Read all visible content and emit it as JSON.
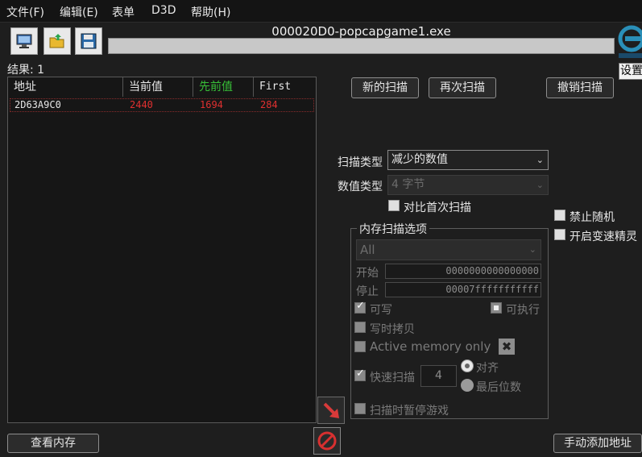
{
  "menu": [
    "文件(F)",
    "编辑(E)",
    "表单",
    "D3D",
    "帮助(H)"
  ],
  "process_title": "000020D0-popcapgame1.exe",
  "settings_label": "设置",
  "result_label": "结果: 1",
  "columns": [
    "地址",
    "当前值",
    "先前值",
    "First"
  ],
  "rows": [
    {
      "address": "2D63A9C0",
      "current": "2440",
      "previous": "1694",
      "first": "284"
    }
  ],
  "buttons": {
    "new_scan": "新的扫描",
    "next_scan": "再次扫描",
    "undo_scan": "撤销扫描",
    "view_memory": "查看内存",
    "add_address": "手动添加地址"
  },
  "scan_type": {
    "label": "扫描类型",
    "value": "减少的数值"
  },
  "value_type": {
    "label": "数值类型",
    "value": "4 字节"
  },
  "compare_first": "对比首次扫描",
  "no_random": "禁止随机",
  "speedhack": "开启变速精灵",
  "memory_options": {
    "title": "内存扫描选项",
    "region": "All",
    "start_label": "开始",
    "start_value": "0000000000000000",
    "stop_label": "停止",
    "stop_value": "00007fffffffffff",
    "writable": "可写",
    "executable": "可执行",
    "copy_on_write": "写时拷贝",
    "active_memory": "Active memory only",
    "fast_scan": "快速扫描",
    "fast_scan_value": "4",
    "align": "对齐",
    "last_digits": "最后位数",
    "pause_game": "扫描时暂停游戏"
  },
  "colors": {
    "background": "#1e1e1e",
    "previous_header": "#38c038",
    "row_text": "#e03030"
  }
}
